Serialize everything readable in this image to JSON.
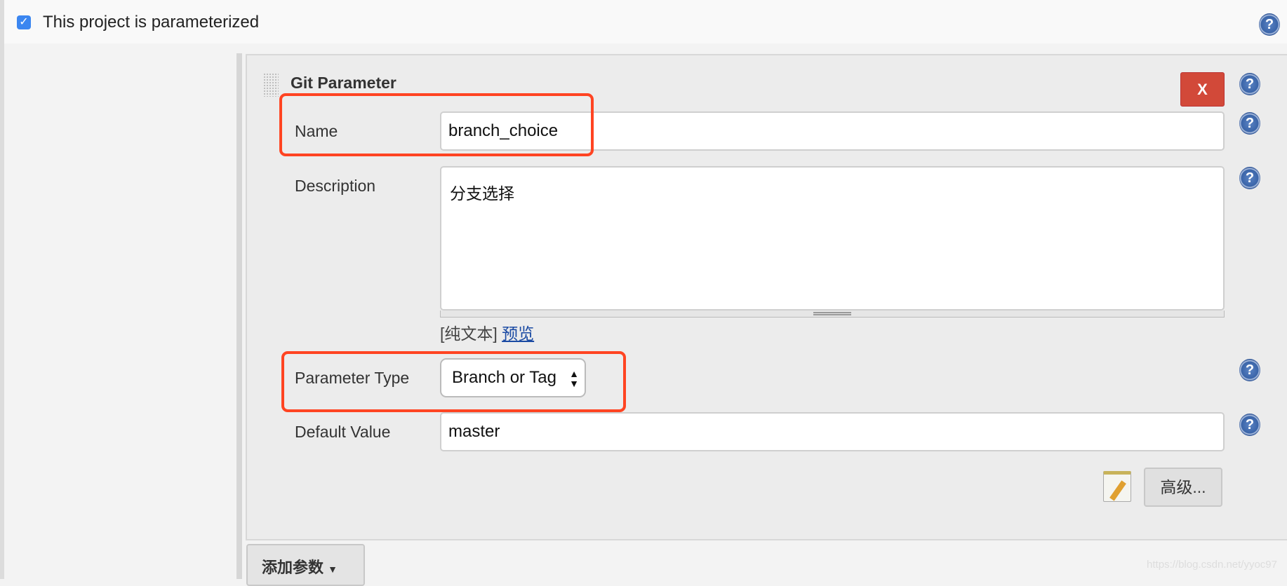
{
  "parameterized": {
    "checked": true,
    "label": "This project is parameterized",
    "checkmark": "✓"
  },
  "help_glyph": "?",
  "parameter": {
    "title": "Git Parameter",
    "delete_label": "X",
    "name": {
      "label": "Name",
      "value": "branch_choice"
    },
    "description": {
      "label": "Description",
      "value": "分支选择",
      "format_label": "[纯文本]",
      "preview_link": "预览"
    },
    "parameter_type": {
      "label": "Parameter Type",
      "value": "Branch or Tag",
      "arrows": "▲▼"
    },
    "default_value": {
      "label": "Default Value",
      "value": "master"
    },
    "advanced_label": "高级..."
  },
  "add_parameter": {
    "label": "添加参数",
    "caret": "▼"
  },
  "watermark": "https://blog.csdn.net/yyoc97",
  "colors": {
    "delete": "#d24939",
    "highlight": "#ff4422",
    "checkbox": "#3b86f0"
  }
}
